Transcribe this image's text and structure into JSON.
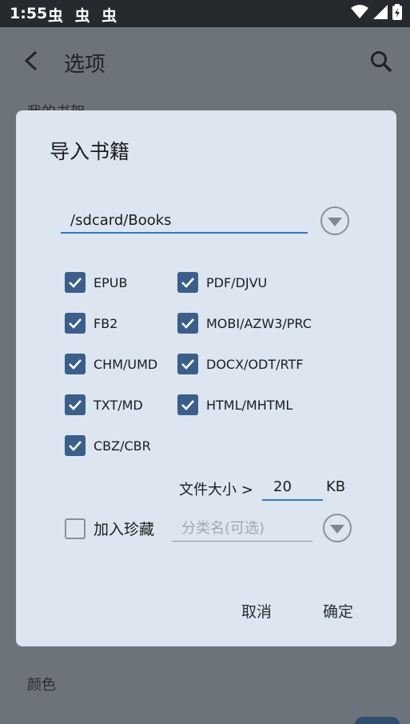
{
  "status_bar": {
    "time": "1:55",
    "notification_icons": "虫 虫 虫"
  },
  "app": {
    "title": "选项",
    "bg_item_top": "我的书架",
    "bg_item_color": "颜色"
  },
  "dialog": {
    "title": "导入书籍",
    "path_value": "/sdcard/Books",
    "formats": [
      {
        "label": "EPUB",
        "checked": true
      },
      {
        "label": "PDF/DJVU",
        "checked": true
      },
      {
        "label": "FB2",
        "checked": true
      },
      {
        "label": "MOBI/AZW3/PRC",
        "checked": true
      },
      {
        "label": "CHM/UMD",
        "checked": true
      },
      {
        "label": "DOCX/ODT/RTF",
        "checked": true
      },
      {
        "label": "TXT/MD",
        "checked": true
      },
      {
        "label": "HTML/MHTML",
        "checked": true
      },
      {
        "label": "CBZ/CBR",
        "checked": true
      }
    ],
    "file_size_label": "文件大小 >",
    "file_size_value": "20",
    "file_size_unit": "KB",
    "favorite_label": "加入珍藏",
    "favorite_checked": false,
    "category_placeholder": "分类名(可选)",
    "cancel_label": "取消",
    "ok_label": "确定"
  },
  "colors": {
    "accent": "#2d7ac8",
    "checkbox": "#3b5f8a",
    "dialog_bg": "#dce5f0",
    "scrim_bg": "#6c737a"
  }
}
